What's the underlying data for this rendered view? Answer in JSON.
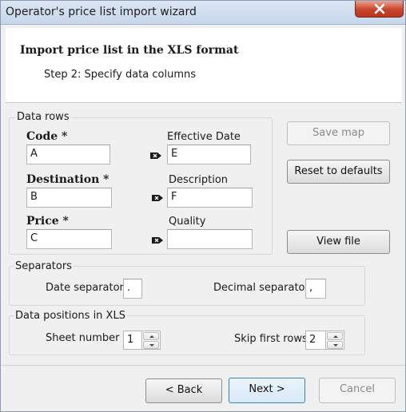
{
  "window": {
    "title": "Operator's price list import wizard"
  },
  "header": {
    "title": "Import price list in the XLS format",
    "step": "Step 2:  Specify data columns"
  },
  "data_rows": {
    "label": "Data rows",
    "code": {
      "label": "Code *",
      "value": "A"
    },
    "destination": {
      "label": "Destination *",
      "value": "B"
    },
    "price": {
      "label": "Price *",
      "value": "C"
    },
    "effective_date": {
      "label": "Effective Date",
      "value": "E"
    },
    "description": {
      "label": "Description",
      "value": "F"
    },
    "quality": {
      "label": "Quality",
      "value": ""
    }
  },
  "side_buttons": {
    "save_map": "Save map",
    "reset_defaults": "Reset to defaults",
    "view_file": "View file"
  },
  "separators": {
    "label": "Separators",
    "date_label": "Date separator",
    "date_value": ".",
    "decimal_label": "Decimal separator",
    "decimal_value": ","
  },
  "positions": {
    "label": "Data positions in XLS",
    "sheet_label": "Sheet number",
    "sheet_value": "1",
    "skip_label": "Skip first rows",
    "skip_value": "2"
  },
  "footer": {
    "back": "< Back",
    "next": "Next >",
    "cancel": "Cancel"
  }
}
